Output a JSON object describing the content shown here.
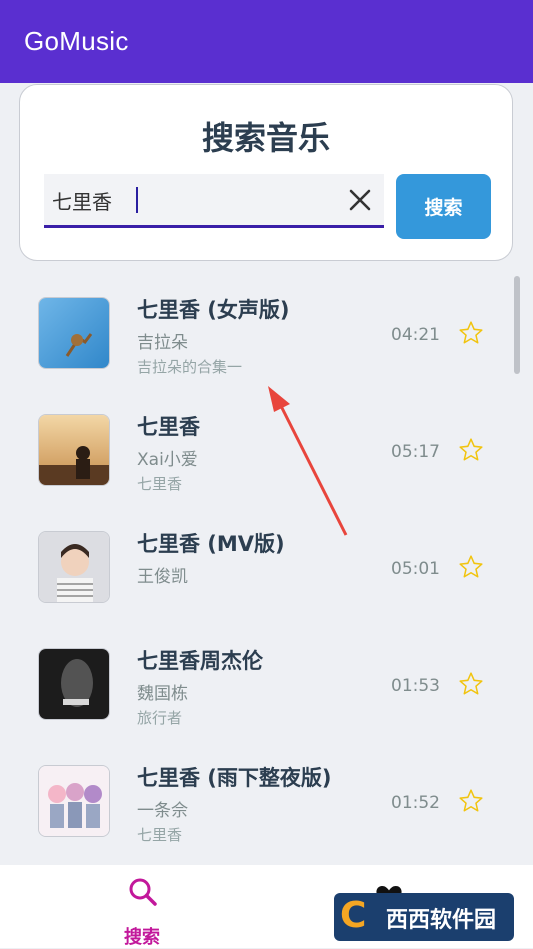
{
  "app": {
    "title": "GoMusic"
  },
  "search": {
    "heading": "搜索音乐",
    "query": "七里香",
    "button_label": "搜索"
  },
  "results": [
    {
      "song": "七里香 (女声版)",
      "artist": "吉拉朵",
      "album": "吉拉朵的合集一",
      "duration": "04:21"
    },
    {
      "song": "七里香",
      "artist": "Xai小爱",
      "album": "七里香",
      "duration": "05:17"
    },
    {
      "song": "七里香 (MV版)",
      "artist": "王俊凯",
      "album": "",
      "duration": "05:01"
    },
    {
      "song": "七里香周杰伦",
      "artist": "魏国栋",
      "album": "旅行者",
      "duration": "01:53"
    },
    {
      "song": "七里香 (雨下整夜版)",
      "artist": "一条佘",
      "album": "七里香",
      "duration": "01:52"
    }
  ],
  "nav": {
    "search_label": "搜索",
    "favorites_icon": "heart-icon"
  },
  "watermark": {
    "text": "西西软件园"
  },
  "colors": {
    "app_bar": "#5a2fd0",
    "search_button": "#3498db",
    "nav_active": "#c2189b",
    "star": "#f1c40f"
  }
}
